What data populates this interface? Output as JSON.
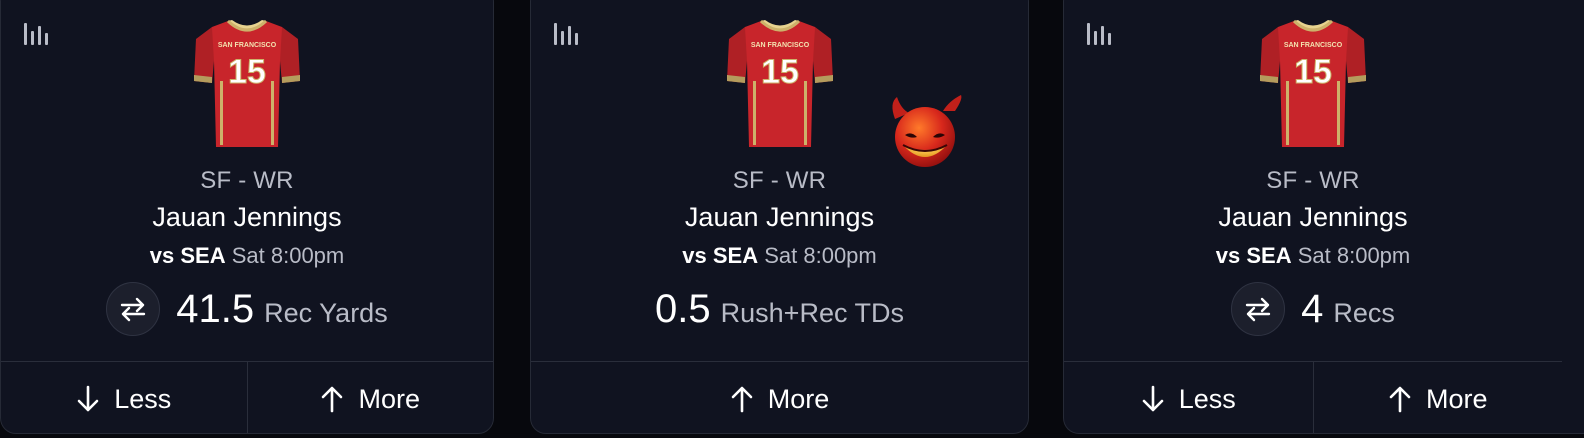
{
  "colors": {
    "page_bg": "#07080d",
    "card_bg": "#101320",
    "card_border": "#262a36",
    "muted_text": "#b9bcc7",
    "jersey_red": "#c8252b",
    "jersey_gold": "#cdb26a"
  },
  "icons": {
    "stats": "bar-chart-icon",
    "swap": "swap-arrows-icon",
    "less": "arrow-down-icon",
    "more": "arrow-up-icon",
    "jersey": "jersey-icon",
    "badge": "demon-emoji-icon"
  },
  "cards": [
    {
      "jersey_team": "SAN FRANCISCO",
      "jersey_number": "15",
      "position": "SF - WR",
      "player": "Jauan Jennings",
      "opponent_prefix": "vs",
      "opponent": "SEA",
      "time": "Sat 8:00pm",
      "line_value": "41.5",
      "line_stat": "Rec Yards",
      "less_label": "Less",
      "more_label": "More"
    },
    {
      "jersey_team": "SAN FRANCISCO",
      "jersey_number": "15",
      "position": "SF - WR",
      "player": "Jauan Jennings",
      "opponent_prefix": "vs",
      "opponent": "SEA",
      "time": "Sat 8:00pm",
      "line_value": "0.5",
      "line_stat": "Rush+Rec TDs",
      "more_label": "More"
    },
    {
      "jersey_team": "SAN FRANCISCO",
      "jersey_number": "15",
      "position": "SF - WR",
      "player": "Jauan Jennings",
      "opponent_prefix": "vs",
      "opponent": "SEA",
      "time": "Sat 8:00pm",
      "line_value": "4",
      "line_stat": "Recs",
      "less_label": "Less",
      "more_label": "More"
    }
  ]
}
